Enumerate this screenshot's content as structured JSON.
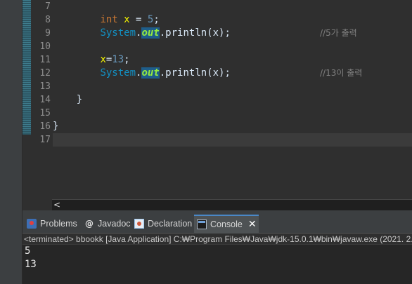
{
  "editor": {
    "line_numbers": [
      "7",
      "8",
      "9",
      "10",
      "11",
      "12",
      "13",
      "14",
      "15",
      "16",
      "17"
    ],
    "lines": [
      {
        "num": "7"
      },
      {
        "num": "8",
        "kw": "int",
        "var": "x",
        "op1": " = ",
        "val": "5",
        "end": ";"
      },
      {
        "num": "9",
        "cls": "System",
        "dot1": ".",
        "field": "out",
        "call": ".println(x);",
        "comment": "//5가 출력"
      },
      {
        "num": "10"
      },
      {
        "num": "11",
        "var": "x",
        "op1": "=",
        "val": "13",
        "end": ";"
      },
      {
        "num": "12",
        "cls": "System",
        "dot1": ".",
        "field": "out",
        "call": ".println(x);",
        "comment": "//13이 출력"
      },
      {
        "num": "13"
      },
      {
        "num": "14",
        "brace": "}"
      },
      {
        "num": "15"
      },
      {
        "num": "16",
        "brace": "}"
      },
      {
        "num": "17"
      }
    ],
    "scroll_left_glyph": "<"
  },
  "panel": {
    "tabs": [
      {
        "label": "Problems"
      },
      {
        "label": "Javadoc",
        "icon_char": "@"
      },
      {
        "label": "Declaration"
      },
      {
        "label": "Console",
        "close": "✕"
      }
    ],
    "status_line": "<terminated> bbookk [Java Application] C:₩Program Files₩Java₩jdk-15.0.1₩bin₩javaw.exe  (2021. 2.",
    "output": [
      "5",
      "13"
    ]
  }
}
